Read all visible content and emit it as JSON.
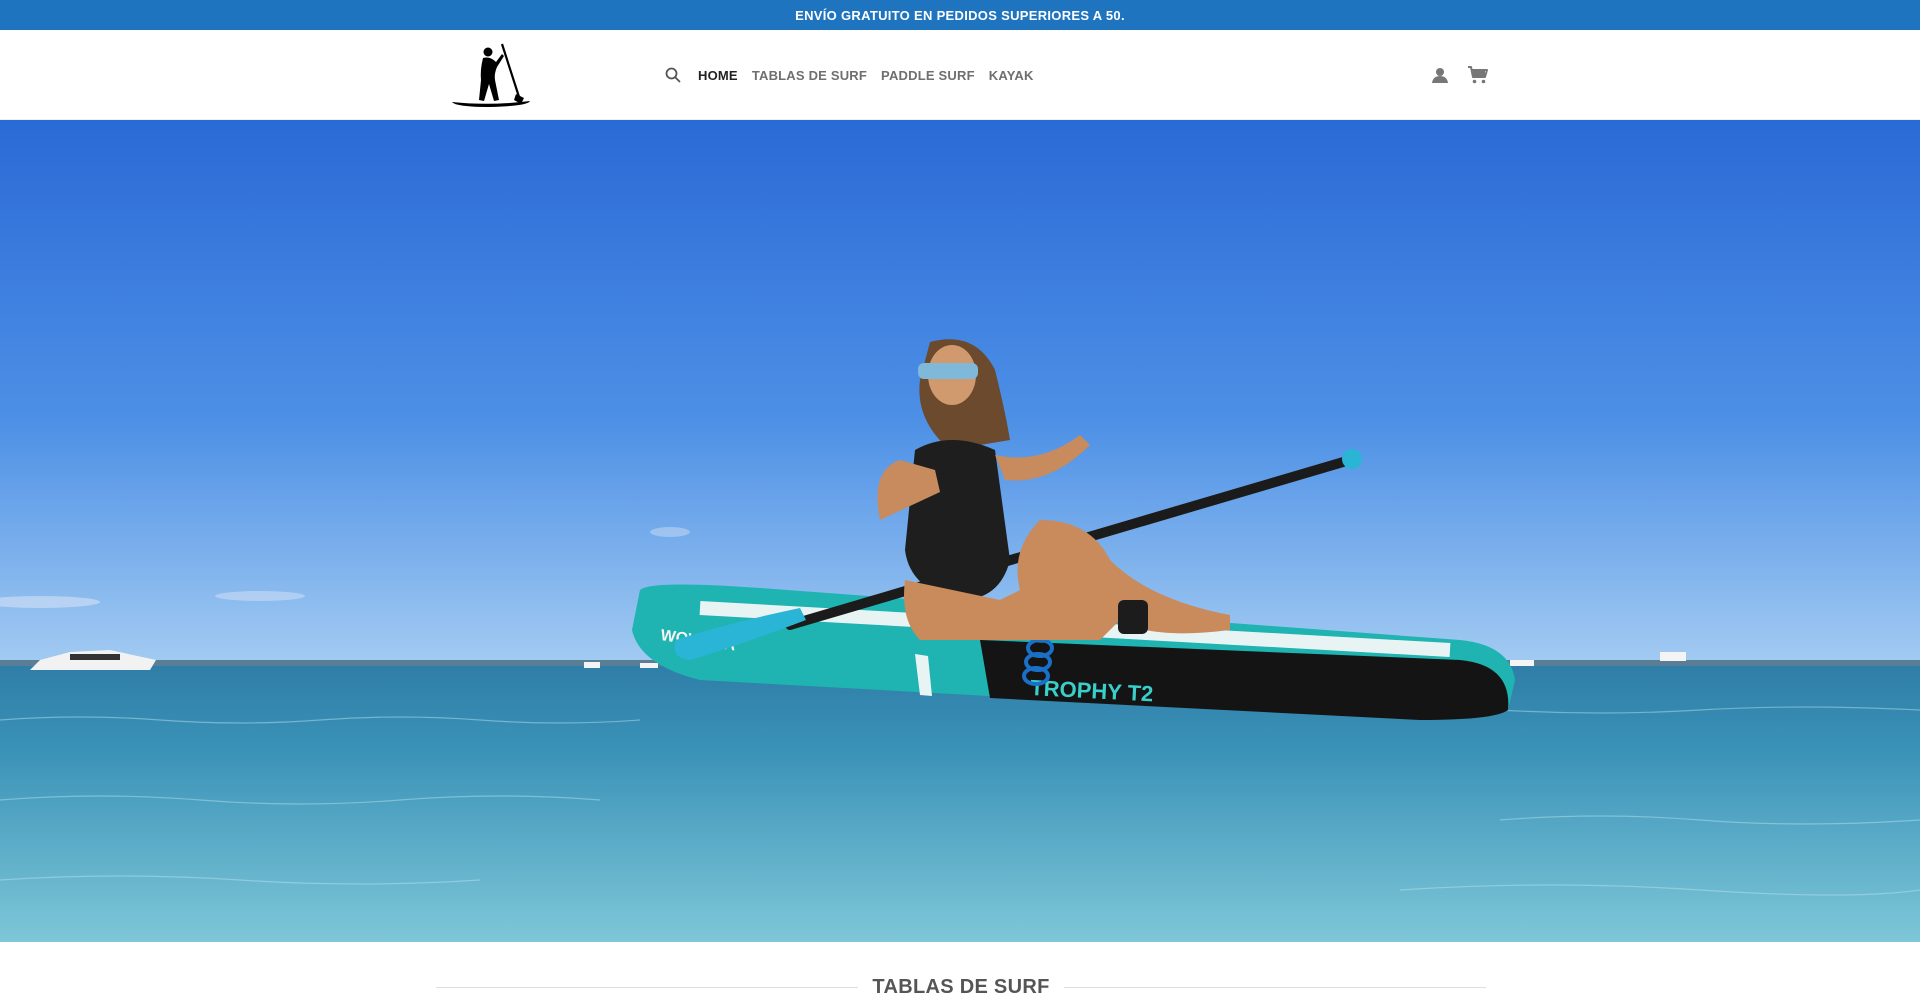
{
  "announcement": {
    "text": "ENVÍO GRATUITO EN PEDIDOS SUPERIORES A 50."
  },
  "nav": {
    "items": [
      {
        "label": "HOME",
        "active": true
      },
      {
        "label": "TABLAS DE SURF",
        "active": false
      },
      {
        "label": "PADDLE SURF",
        "active": false
      },
      {
        "label": "KAYAK",
        "active": false
      }
    ]
  },
  "icons": {
    "search": "search-icon",
    "account": "user-icon",
    "cart": "cart-icon",
    "logo": "paddle-surfer-logo"
  },
  "hero": {
    "board_brand": "WOWSEA",
    "board_model": "TROPHY T2"
  },
  "section": {
    "title": "TABLAS DE SURF"
  },
  "colors": {
    "announcement_bg": "#1f74bf",
    "nav_active": "#222222",
    "nav_inactive": "#6f6f6f"
  }
}
